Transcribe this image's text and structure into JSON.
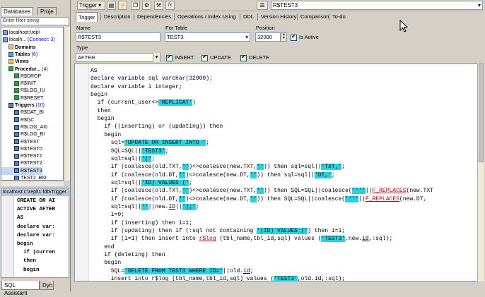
{
  "left_panel": {
    "tabs": [
      "Databases",
      "Proje"
    ],
    "filter_placeholder": "Enter filter string",
    "tree": [
      {
        "label": "localhost:\\rep\\",
        "icon": "db",
        "indent": 0
      },
      {
        "label": "localh...",
        "count": "(Connect: 3)",
        "icon": "db",
        "indent": 0
      },
      {
        "label": "Domains",
        "icon": "fd",
        "indent": 1
      },
      {
        "label": "Tables",
        "count": "(6)",
        "icon": "tb",
        "indent": 1
      },
      {
        "label": "Views",
        "icon": "fd",
        "indent": 1
      },
      {
        "label": "Procedur...",
        "count": "(4)",
        "icon": "pr",
        "indent": 1
      },
      {
        "label": "R$DROP",
        "icon": "pr",
        "indent": 2
      },
      {
        "label": "R$INIT",
        "icon": "pr",
        "indent": 2
      },
      {
        "label": "R$LOG_IU",
        "icon": "pr",
        "indent": 2
      },
      {
        "label": "R$RESET",
        "icon": "pr",
        "indent": 2
      },
      {
        "label": "Triggers",
        "count": "(10)",
        "icon": "tr",
        "indent": 1
      },
      {
        "label": "R$DAT_BI",
        "icon": "tr",
        "indent": 2
      },
      {
        "label": "R$GC",
        "icon": "tr",
        "indent": 2
      },
      {
        "label": "R$LOG_AI0",
        "icon": "tr",
        "indent": 2
      },
      {
        "label": "R$LOG_BI",
        "icon": "tr",
        "indent": 2
      },
      {
        "label": "R$TEST",
        "icon": "tr",
        "indent": 2
      },
      {
        "label": "R$TEST0",
        "icon": "tr",
        "indent": 2
      },
      {
        "label": "R$TEST1",
        "icon": "tr",
        "indent": 2
      },
      {
        "label": "R$TEST2",
        "icon": "tr",
        "indent": 2
      },
      {
        "label": "R$TEST3",
        "icon": "tr",
        "indent": 2,
        "selected": true
      },
      {
        "label": "TEST2_BI0",
        "icon": "tr",
        "indent": 2
      }
    ],
    "ddl_header": "localhost:c:\\repl\\1.fdb\\Trigger",
    "ddl_lines": [
      "CREATE OR AI",
      "ACTIVE AFTER",
      "AS",
      "declare var:",
      "declare var:",
      "begin",
      "  if (curren",
      "  then",
      "  begin"
    ],
    "bottom_tabs": [
      "SQL Assistant",
      "Dyn"
    ]
  },
  "toolbar": {
    "trigger_label": "Trigger",
    "object_name": "R$TEST3"
  },
  "tabs": [
    "Trigger",
    "Description",
    "Dependencies",
    "Operations / Index Using",
    "DDL",
    "Version History",
    "Comparison",
    "To-do"
  ],
  "form": {
    "name_label": "Name",
    "name_value": "R$TEST3",
    "table_label": "For Table",
    "table_value": "TEST3",
    "position_label": "Position",
    "position_value": "32000",
    "is_active_label": "Is Active",
    "type_label": "Type",
    "type_value": "AFTER",
    "insert_label": "INSERT",
    "update_label": "UPDATE",
    "delete_label": "DELETE"
  },
  "code": [
    [
      [
        "AS",
        ""
      ]
    ],
    [
      [
        "declare variable sql varchar(32000);",
        ""
      ]
    ],
    [
      [
        "declare variable i integer;",
        ""
      ]
    ],
    [
      [
        "begin",
        ""
      ]
    ],
    [
      [
        "  if (current_user<>",
        ""
      ],
      [
        "'REPLICAT'",
        "str"
      ],
      [
        ")",
        ""
      ]
    ],
    [
      [
        "  then",
        ""
      ]
    ],
    [
      [
        "  begin",
        ""
      ]
    ],
    [
      [
        "    if ((inserting) or (updating)) then",
        ""
      ]
    ],
    [
      [
        "    begin",
        ""
      ]
    ],
    [
      [
        "      sql=",
        ""
      ],
      [
        "'UPDATE OR INSERT INTO '",
        "str"
      ],
      [
        ";",
        ""
      ]
    ],
    [
      [
        "      SQL=SQL||",
        ""
      ],
      [
        "'TEST3'",
        "str"
      ],
      [
        ";",
        ""
      ]
    ],
    [
      [
        "      sql=sql||",
        ""
      ],
      [
        "'('",
        "str"
      ],
      [
        ";",
        ""
      ]
    ],
    [
      [
        "      if (coalesce(old.TXT,",
        ""
      ],
      [
        "''",
        "str"
      ],
      [
        ")<>coalesce(new.TXT,",
        ""
      ],
      [
        "''",
        "str"
      ],
      [
        ")) then sql=sql||",
        ""
      ],
      [
        "'TXT,'",
        "str"
      ],
      [
        ";",
        ""
      ]
    ],
    [
      [
        "      if (coalesce(old.DT,",
        ""
      ],
      [
        "''",
        "str"
      ],
      [
        ")<>coalesce(new.DT,",
        ""
      ],
      [
        "''",
        "str"
      ],
      [
        ")) then sql=sql||",
        ""
      ],
      [
        "'DT,'",
        "str"
      ],
      [
        ";",
        ""
      ]
    ],
    [
      [
        "      sql=sql||",
        ""
      ],
      [
        "'ID) VALUES ('",
        "str"
      ],
      [
        ";",
        ""
      ]
    ],
    [
      [
        "      if (coalesce(old.TXT,",
        ""
      ],
      [
        "''",
        "str"
      ],
      [
        ")<>coalesce(new.TXT,",
        ""
      ],
      [
        "''",
        "str"
      ],
      [
        ")) then SQL=SQL||coalesce(",
        ""
      ],
      [
        "''''",
        "str"
      ],
      [
        "||",
        ""
      ],
      [
        "F_REPLACES",
        "fn und"
      ],
      [
        "(new.TXT",
        ""
      ]
    ],
    [
      [
        "      if (coalesce(old.DT,",
        ""
      ],
      [
        "''",
        "str"
      ],
      [
        ")<>coalesce(new.DT,",
        ""
      ],
      [
        "''",
        "str"
      ],
      [
        ")) then SQL=SQL||coalesce(",
        ""
      ],
      [
        "''''",
        "str"
      ],
      [
        "||",
        ""
      ],
      [
        "F_REPLACES",
        "fn und"
      ],
      [
        "(new.DT,",
        ""
      ]
    ],
    [
      [
        "      sql=sql||",
        ""
      ],
      [
        "''",
        "str"
      ],
      [
        "||new.",
        ""
      ],
      [
        "ID",
        "und"
      ],
      [
        "||",
        ""
      ],
      [
        "');'",
        "str"
      ],
      [
        ";",
        ""
      ]
    ],
    [
      [
        "      i=0;",
        ""
      ]
    ],
    [
      [
        "      if (inserting) then i=1;",
        ""
      ]
    ],
    [
      [
        "      if (updating) then if (:sql not containing ",
        ""
      ],
      [
        "'(ID) VALUES ('",
        "str"
      ],
      [
        ") then i=1;",
        ""
      ]
    ],
    [
      [
        "      if (i=1) then insert into ",
        ""
      ],
      [
        "r$log",
        "fn und"
      ],
      [
        " (tbl_name,tbl_id,sql) values (",
        ""
      ],
      [
        "'TEST3'",
        "str"
      ],
      [
        ",new.",
        ""
      ],
      [
        "id",
        "und"
      ],
      [
        ",:sql);",
        ""
      ]
    ],
    [
      [
        "    end",
        ""
      ]
    ],
    [
      [
        "    if (deleting) then",
        ""
      ]
    ],
    [
      [
        "    begin",
        ""
      ]
    ],
    [
      [
        "      SQL=",
        ""
      ],
      [
        "'DELETE FROM TEST3 WHERE ID='",
        "str"
      ],
      [
        "||old.",
        ""
      ],
      [
        "id",
        "und"
      ],
      [
        ";",
        ""
      ]
    ],
    [
      [
        "      insert into r$log (tbl_name,tbl_id,sql) values (",
        ""
      ],
      [
        "'TEST3'",
        "str"
      ],
      [
        ",old.id,:sql);",
        ""
      ]
    ]
  ]
}
